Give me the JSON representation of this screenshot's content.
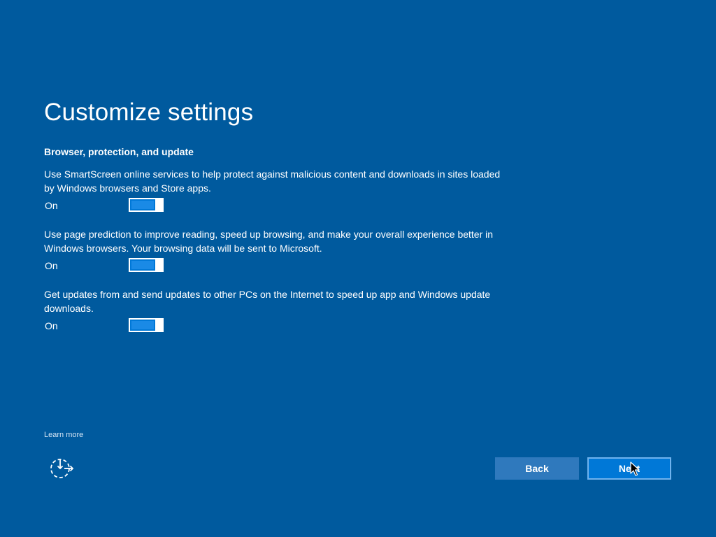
{
  "title": "Customize settings",
  "section_heading": "Browser, protection, and update",
  "settings": [
    {
      "description": "Use SmartScreen online services to help protect against malicious content and downloads in sites loaded by Windows browsers and Store apps.",
      "state": "On",
      "enabled": true
    },
    {
      "description": "Use page prediction to improve reading, speed up browsing, and make your overall experience better in Windows browsers. Your browsing data will be sent to Microsoft.",
      "state": "On",
      "enabled": true
    },
    {
      "description": "Get updates from and send updates to other PCs on the Internet to speed up app and Windows update downloads.",
      "state": "On",
      "enabled": true
    }
  ],
  "footer": {
    "learn_more": "Learn more",
    "ease_of_access_icon": "ease-of-access-icon",
    "back_label": "Back",
    "next_label": "Next"
  },
  "colors": {
    "background": "#005a9e",
    "toggle_on": "#0078d7",
    "text": "#ffffff"
  }
}
